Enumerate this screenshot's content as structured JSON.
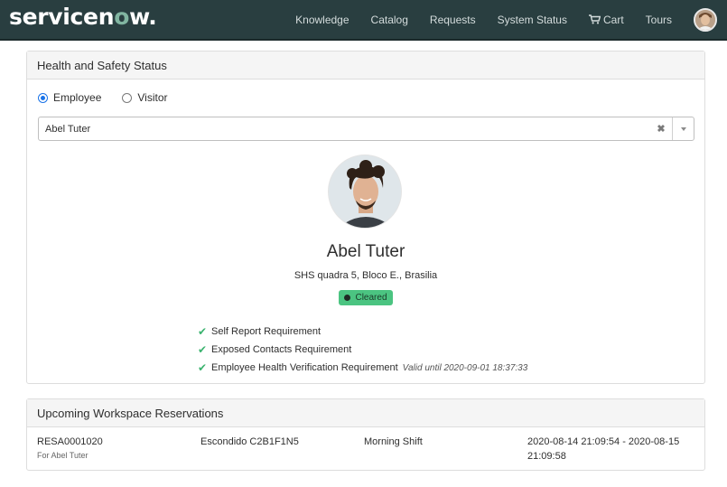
{
  "header": {
    "logo_main": "servicen",
    "logo_o": "o",
    "logo_end": "w.",
    "nav": [
      {
        "label": "Knowledge"
      },
      {
        "label": "Catalog"
      },
      {
        "label": "Requests"
      },
      {
        "label": "System Status"
      },
      {
        "label": "Cart"
      },
      {
        "label": "Tours"
      }
    ]
  },
  "health_panel": {
    "title": "Health and Safety Status",
    "radio_employee": "Employee",
    "radio_visitor": "Visitor",
    "selected_radio": "Employee",
    "select_value": "Abel Tuter",
    "clear_glyph": "✖",
    "profile": {
      "name": "Abel Tuter",
      "address": "SHS quadra 5, Bloco E., Brasilia",
      "status": "Cleared"
    },
    "requirements": [
      {
        "label": "Self Report Requirement",
        "valid": ""
      },
      {
        "label": "Exposed Contacts Requirement",
        "valid": ""
      },
      {
        "label": "Employee Health Verification Requirement",
        "valid": "Valid until 2020-09-01 18:37:33"
      }
    ],
    "check_glyph": "✔"
  },
  "reservations_panel": {
    "title": "Upcoming Workspace Reservations",
    "rows": [
      {
        "number": "RESA0001020",
        "for": "For Abel Tuter",
        "location": "Escondido C2B1F1N5",
        "shift": "Morning Shift",
        "range": "2020-08-14 21:09:54 - 2020-08-15 21:09:58"
      }
    ]
  },
  "colors": {
    "header_bg": "#293e40",
    "accent_green": "#81b5a1",
    "badge_green": "#4bc481",
    "check_green": "#3bb36f",
    "radio_blue": "#1a73e8"
  }
}
